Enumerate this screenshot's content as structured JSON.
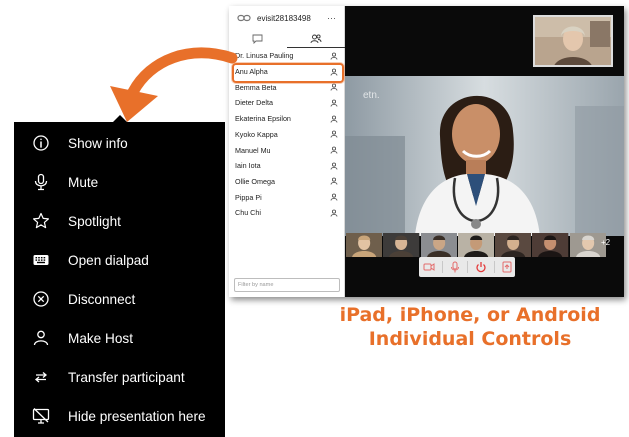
{
  "colors": {
    "accent": "#e8702a",
    "menu_bg": "#000000",
    "menu_text": "#ffffff",
    "app_bg": "#111111"
  },
  "sidebar": {
    "room_id": "evisit28183498",
    "more_icon": "⋯",
    "participants": [
      {
        "name": "Dr. Linusa Pauling"
      },
      {
        "name": "Anu Alpha"
      },
      {
        "name": "Bemma Beta"
      },
      {
        "name": "Dieter Delta"
      },
      {
        "name": "Ekaterina Epsilon"
      },
      {
        "name": "Kyoko Kappa"
      },
      {
        "name": "Manuel Mu"
      },
      {
        "name": "Iain Iota"
      },
      {
        "name": "Ollie Omega"
      },
      {
        "name": "Pippa Pi"
      },
      {
        "name": "Chu Chi"
      }
    ],
    "filter_placeholder": "Filter by name"
  },
  "video": {
    "overflow_count": "+2",
    "watermark": "etn."
  },
  "menu": {
    "items": [
      {
        "label": "Show info",
        "icon": "info-icon"
      },
      {
        "label": "Mute",
        "icon": "microphone-icon"
      },
      {
        "label": "Spotlight",
        "icon": "star-icon"
      },
      {
        "label": "Open dialpad",
        "icon": "dialpad-icon"
      },
      {
        "label": "Disconnect",
        "icon": "disconnect-icon"
      },
      {
        "label": "Make Host",
        "icon": "person-icon"
      },
      {
        "label": "Transfer participant",
        "icon": "transfer-icon"
      },
      {
        "label": "Hide presentation here",
        "icon": "hide-presentation-icon"
      }
    ]
  },
  "caption": {
    "line1": "iPad, iPhone, or Android",
    "line2": "Individual Controls"
  }
}
